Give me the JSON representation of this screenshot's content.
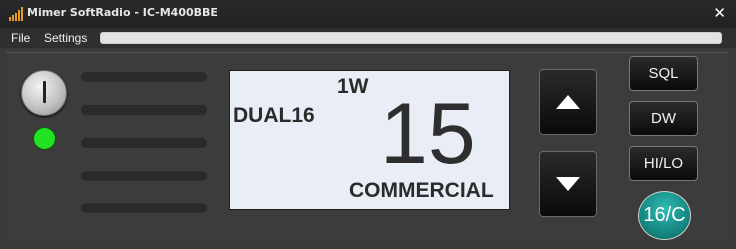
{
  "window": {
    "title": "Mimer SoftRadio - IC-M400BBE",
    "close_glyph": "✕"
  },
  "menu": {
    "items": [
      "File",
      "Settings"
    ]
  },
  "progress": {
    "value": 0
  },
  "radio": {
    "power_button_icon": "power-icon",
    "led_color": "#22e222",
    "display": {
      "power_level": "1W",
      "mode": "DUAL16",
      "channel": "15",
      "channel_name": "COMMERCIAL"
    },
    "buttons": {
      "up_icon": "arrow-up-icon",
      "down_icon": "arrow-down-icon",
      "sql": "SQL",
      "dw": "DW",
      "hilo": "HI/LO",
      "ch16": "16/C"
    }
  }
}
